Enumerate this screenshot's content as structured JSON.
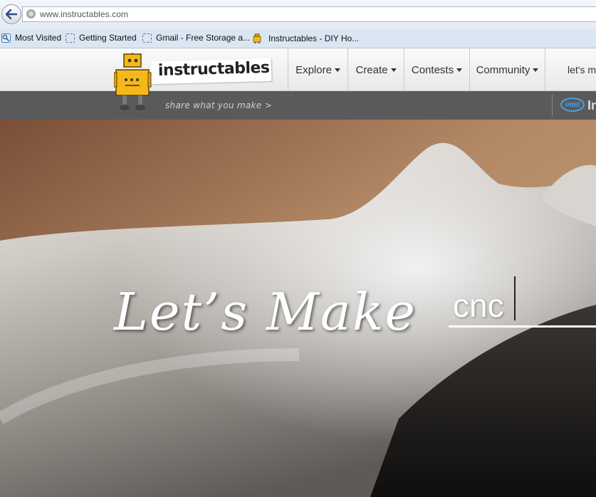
{
  "browser": {
    "url": "www.instructables.com",
    "bookmarks": [
      {
        "label": "Most Visited",
        "icon": "most-visited-icon"
      },
      {
        "label": "Getting Started",
        "icon": "page-icon"
      },
      {
        "label": "Gmail - Free Storage a...",
        "icon": "page-icon"
      },
      {
        "label": "Instructables - DIY Ho...",
        "icon": "instructables-favicon"
      }
    ]
  },
  "site": {
    "logo_text": "instructables",
    "tagline": "share what you make  >",
    "nav": [
      {
        "label": "Explore"
      },
      {
        "label": "Create"
      },
      {
        "label": "Contests"
      },
      {
        "label": "Community"
      },
      {
        "label": "let's m"
      }
    ],
    "sponsor_text": "In",
    "sponsor_logo": "intel"
  },
  "hero": {
    "title": "Let’s Make",
    "search_value": "cnc"
  },
  "colors": {
    "robot_yellow": "#f5b81a",
    "subbar": "#5a5a5a",
    "intel_blue": "#4aa0e0"
  }
}
